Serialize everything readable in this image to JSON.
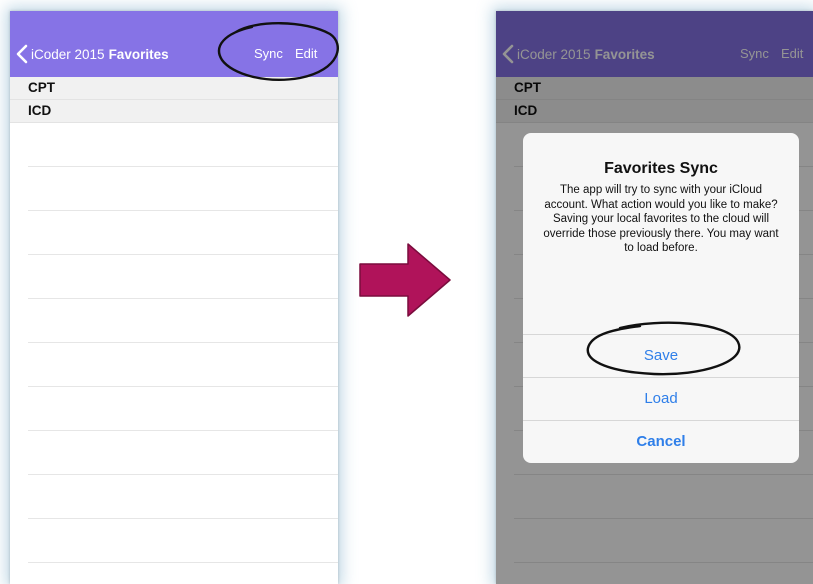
{
  "left_screen": {
    "nav": {
      "back_label": "iCoder 2015",
      "title": "Favorites",
      "sync_label": "Sync",
      "edit_label": "Edit"
    },
    "sections": [
      {
        "label": "CPT"
      },
      {
        "label": "ICD"
      }
    ]
  },
  "right_screen": {
    "nav": {
      "back_label": "iCoder 2015",
      "title": "Favorites",
      "sync_label": "Sync",
      "edit_label": "Edit"
    },
    "sections": [
      {
        "label": "CPT"
      },
      {
        "label": "ICD"
      }
    ],
    "alert": {
      "title": "Favorites Sync",
      "message": "The app will try to sync with your iCloud account.  What action would you like to make? Saving your local favorites to the cloud will override those previously there.  You may want to load before.",
      "buttons": [
        {
          "label": "Save"
        },
        {
          "label": "Load"
        },
        {
          "label": "Cancel"
        }
      ]
    }
  },
  "colors": {
    "nav_bar": "#8673e6",
    "arrow": "#b0135a",
    "annotation": "#111111",
    "button_text": "#2f7fe9"
  }
}
